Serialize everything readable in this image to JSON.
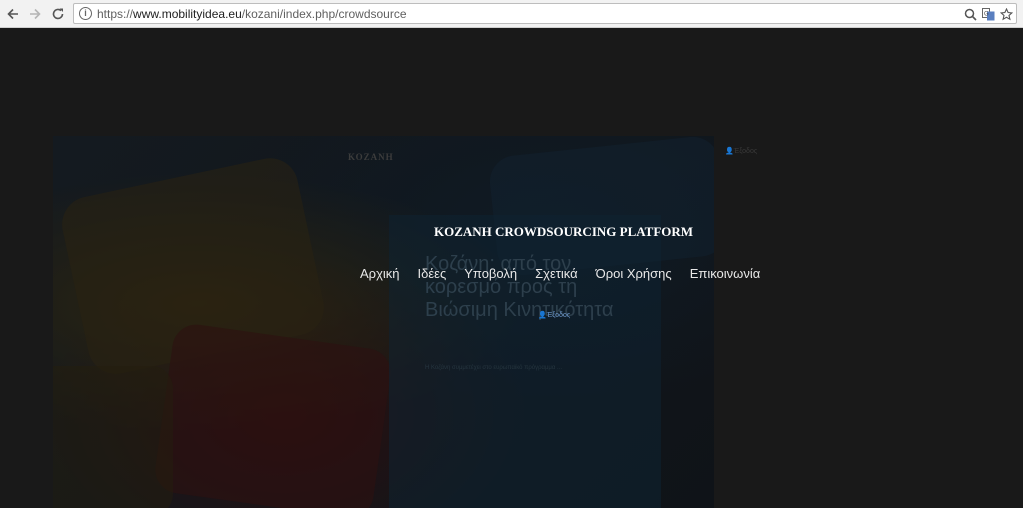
{
  "browser": {
    "url_scheme": "https://",
    "url_host": "www.mobilityidea.eu",
    "url_path": "/kozani/index.php/crowdsource",
    "icons": [
      "back-arrow-icon",
      "forward-arrow-icon",
      "reload-icon",
      "info-icon",
      "zoom-icon",
      "translate-icon",
      "bookmark-star-icon"
    ]
  },
  "hero": {
    "logo": "ΚΟΖΑΝΗ",
    "heading": "Κοζάνη: από τον κορεσμό προς τη Βιώσιμη Κινητικότητα",
    "body": "Η Κοζάνη συμμετέχει στο ευρωπαϊκό πρόγραμμα ...",
    "date": ""
  },
  "header": {
    "site_title": "KOZANH CROWDSOURCING PLATFORM",
    "nav": [
      "Αρχική",
      "Ιδέες",
      "Υποβολή",
      "Σχετικά",
      "Όροι Χρήσης",
      "Επικοινωνία"
    ],
    "logout_label": "Έξοδος",
    "user_corner_label": "Έξοδος"
  },
  "colors": {
    "page_bg": "#191919",
    "link": "#6f9bd0",
    "title": "#ffffff"
  }
}
